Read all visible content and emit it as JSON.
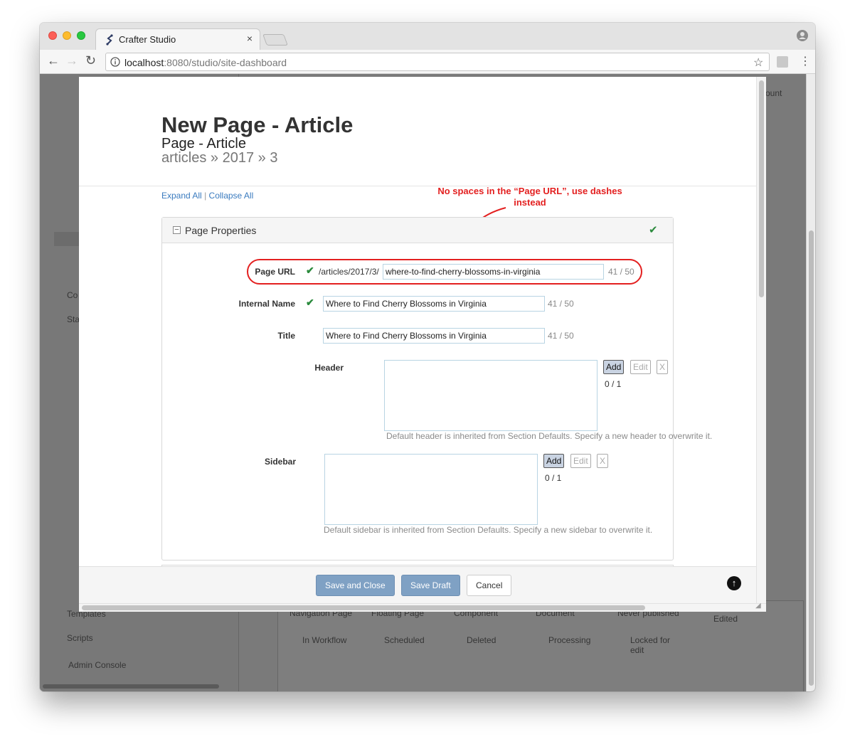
{
  "browser": {
    "tab_title": "Crafter Studio",
    "tab_close": "×",
    "url_host": "localhost",
    "url_rest": ":8080/studio/site-dashboard"
  },
  "background": {
    "account": "ount",
    "sidebar": {
      "templates": "Templates",
      "scripts": "Scripts",
      "admin_console": "Admin Console",
      "co": "Co",
      "sta": "Sta"
    },
    "legend_row1": [
      "Navigation Page",
      "Floating Page",
      "Component",
      "Document",
      "Never published"
    ],
    "legend_edited": "Edited",
    "legend_row2": [
      "In Workflow",
      "Scheduled",
      "Deleted",
      "Processing",
      "Locked for edit"
    ]
  },
  "modal": {
    "title": "New Page - Article",
    "subtitle": "Page - Article",
    "path": "articles » 2017 » 3",
    "expand_all": "Expand All",
    "separator": "|",
    "collapse_all": "Collapse All",
    "annotation": "No spaces in the “Page URL”, use dashes instead",
    "panel_title": "Page Properties",
    "fields": {
      "page_url": {
        "label": "Page URL",
        "prefix": "/articles/2017/3/",
        "value": "where-to-find-cherry-blossoms-in-virginia",
        "count": "41 / 50"
      },
      "internal_name": {
        "label": "Internal Name",
        "value": "Where to Find Cherry Blossoms in Virginia",
        "count": "41 / 50"
      },
      "title": {
        "label": "Title",
        "value": "Where to Find Cherry Blossoms in Virginia",
        "count": "41 / 50"
      },
      "header": {
        "label": "Header",
        "add": "Add",
        "edit": "Edit",
        "remove": "X",
        "count": "0 / 1",
        "help": "Default header is inherited from Section Defaults. Specify a new header to overwrite it."
      },
      "sidebar": {
        "label": "Sidebar",
        "add": "Add",
        "edit": "Edit",
        "remove": "X",
        "count": "0 / 1",
        "help": "Default sidebar is inherited from Section Defaults. Specify a new sidebar to overwrite it."
      }
    },
    "footer": {
      "save_close": "Save and Close",
      "save_draft": "Save Draft",
      "cancel": "Cancel"
    }
  },
  "colors": {
    "accent_red": "#e32020",
    "check_green": "#2a8a3c",
    "primary_button": "#7fa1c4"
  }
}
